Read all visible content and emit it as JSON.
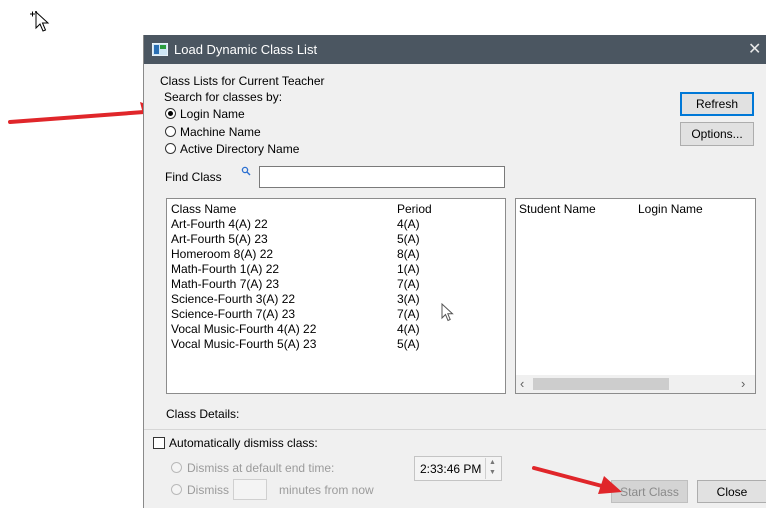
{
  "dialog": {
    "title": "Load Dynamic Class List",
    "close_glyph": "✕"
  },
  "section": {
    "heading": "Class Lists for Current Teacher",
    "search_by": "Search for classes by:",
    "options": [
      {
        "label": "Login Name",
        "selected": true
      },
      {
        "label": "Machine Name",
        "selected": false
      },
      {
        "label": "Active Directory Name",
        "selected": false
      }
    ]
  },
  "buttons": {
    "refresh": "Refresh",
    "options": "Options...",
    "start_class": "Start Class",
    "close": "Close"
  },
  "find": {
    "label": "Find Class",
    "icon": "search-icon",
    "value": ""
  },
  "class_table": {
    "headers": [
      "Class Name",
      "Period"
    ],
    "rows": [
      [
        "Art-Fourth 4(A) 22",
        "4(A)"
      ],
      [
        "Art-Fourth 5(A) 23",
        "5(A)"
      ],
      [
        "Homeroom 8(A) 22",
        "8(A)"
      ],
      [
        "Math-Fourth 1(A) 22",
        "1(A)"
      ],
      [
        "Math-Fourth 7(A) 23",
        "7(A)"
      ],
      [
        "Science-Fourth 3(A) 22",
        "3(A)"
      ],
      [
        "Science-Fourth 7(A) 23",
        "7(A)"
      ],
      [
        "Vocal Music-Fourth 4(A) 22",
        "4(A)"
      ],
      [
        "Vocal Music-Fourth 5(A) 23",
        "5(A)"
      ]
    ]
  },
  "student_table": {
    "headers": [
      "Student Name",
      "Login Name"
    ],
    "scroll_left": "‹",
    "scroll_right": "›"
  },
  "details": {
    "label": "Class Details:"
  },
  "dismiss": {
    "auto_label": "Automatically dismiss class:",
    "at_end_label": "Dismiss at default end time:",
    "dismiss_label": "Dismiss",
    "minutes_label": "minutes from now",
    "time_value": "2:33:46 PM",
    "spin_up": "▲",
    "spin_down": "▼"
  },
  "colors": {
    "titlebar": "#4b5661",
    "annotation_arrow": "#e0262a",
    "default_button_border": "#0078d7"
  }
}
